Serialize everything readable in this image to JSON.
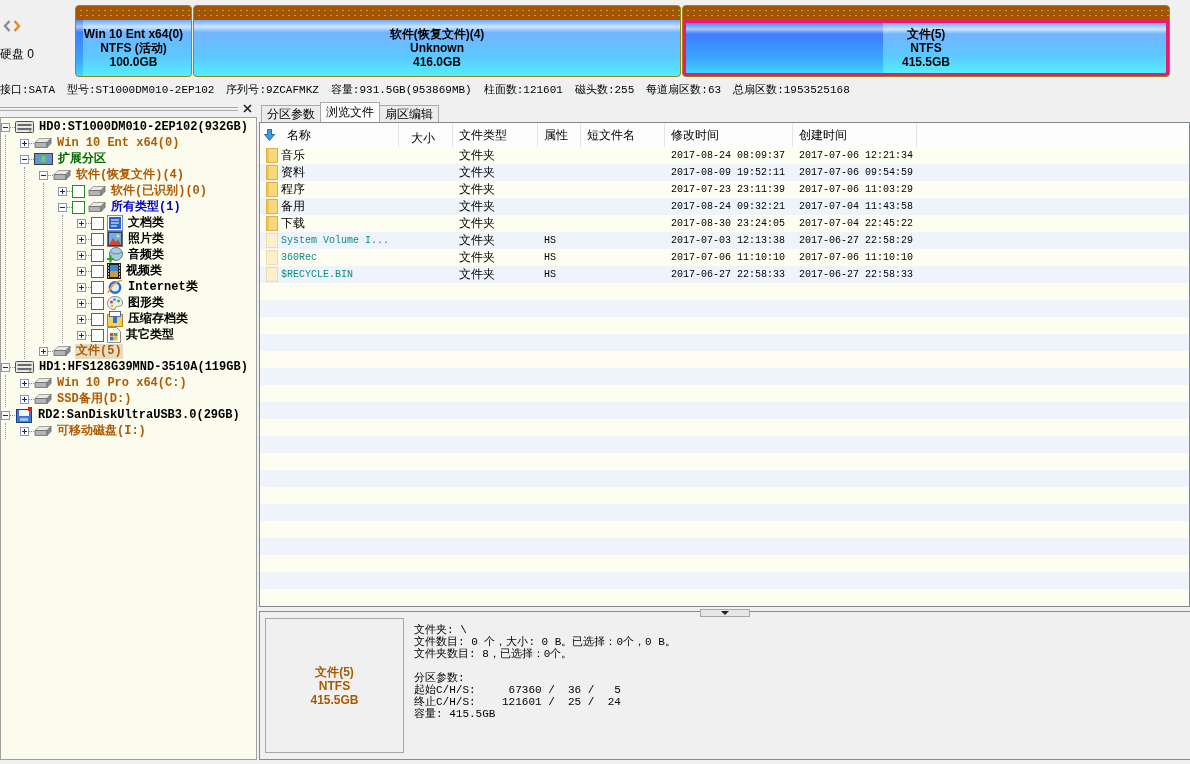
{
  "nav": {
    "disk_label": "硬盘 0"
  },
  "partitions": [
    {
      "name": "Win 10 Ent x64(0)",
      "filesystem": "NTFS (活动)",
      "size": "100.0GB",
      "level": 0.06,
      "selected": false
    },
    {
      "name": "软件(恢复文件)(4)",
      "filesystem": "Unknown",
      "size": "416.0GB",
      "selected": false
    },
    {
      "name": "文件(5)",
      "filesystem": "NTFS",
      "size": "415.5GB",
      "level": 0.41,
      "selected": true
    }
  ],
  "disk_info": [
    "接口:SATA",
    "型号:ST1000DM010-2EP102",
    "序列号:9ZCAFMKZ",
    "容量:931.5GB(953869MB)",
    "柱面数:121601",
    "磁头数:255",
    "每道扇区数:63",
    "总扇区数:1953525168"
  ],
  "tree": [
    {
      "label": "HD0:ST1000DM010-2EP102(932GB)",
      "kind": "disk",
      "color": "#000000",
      "expanded": true,
      "selected": false,
      "children": [
        {
          "label": "Win 10 Ent x64(0)",
          "kind": "partition",
          "color": "#b05a00",
          "expanded": false,
          "selected": false
        },
        {
          "label": "扩展分区",
          "kind": "extended",
          "color": "#006a00",
          "expanded": true,
          "selected": false,
          "children": [
            {
              "label": "软件(恢复文件)(4)",
              "kind": "partition",
              "color": "#b05a00",
              "expanded": true,
              "selected": false,
              "children": [
                {
                  "label": "软件(已识别)(0)",
                  "kind": "partition",
                  "color": "#b05a00",
                  "checked": false,
                  "expanded": false,
                  "selected": false
                },
                {
                  "label": "所有类型(1)",
                  "kind": "partition",
                  "color": "#0000c0",
                  "checked": false,
                  "expanded": true,
                  "selected": false,
                  "children": [
                    {
                      "label": "文档类",
                      "kind": "document",
                      "color": "#000000",
                      "checked": false,
                      "expanded": false,
                      "selected": false
                    },
                    {
                      "label": "照片类",
                      "kind": "photo",
                      "color": "#000000",
                      "checked": false,
                      "expanded": false,
                      "selected": false
                    },
                    {
                      "label": "音频类",
                      "kind": "audio",
                      "color": "#000000",
                      "checked": false,
                      "expanded": false,
                      "selected": false
                    },
                    {
                      "label": "视频类",
                      "kind": "video",
                      "color": "#000000",
                      "checked": false,
                      "expanded": false,
                      "selected": false
                    },
                    {
                      "label": "Internet类",
                      "kind": "internet",
                      "color": "#000000",
                      "checked": false,
                      "expanded": false,
                      "selected": false
                    },
                    {
                      "label": "图形类",
                      "kind": "graphics",
                      "color": "#000000",
                      "checked": false,
                      "expanded": false,
                      "selected": false
                    },
                    {
                      "label": "压缩存档类",
                      "kind": "archive",
                      "color": "#000000",
                      "checked": false,
                      "expanded": false,
                      "selected": false
                    },
                    {
                      "label": "其它类型",
                      "kind": "other",
                      "color": "#000000",
                      "checked": false,
                      "expanded": false,
                      "selected": false
                    }
                  ]
                }
              ]
            },
            {
              "label": "文件(5)",
              "kind": "partition",
              "color": "#b05a00",
              "expanded": false,
              "selected": true
            }
          ]
        }
      ]
    },
    {
      "label": "HD1:HFS128G39MND-3510A(119GB)",
      "kind": "disk",
      "color": "#000000",
      "expanded": true,
      "selected": false,
      "children": [
        {
          "label": "Win 10 Pro x64(C:)",
          "kind": "partition",
          "color": "#b05a00",
          "expanded": false,
          "selected": false
        },
        {
          "label": "SSD备用(D:)",
          "kind": "partition",
          "color": "#b05a00",
          "expanded": false,
          "selected": false
        }
      ]
    },
    {
      "label": "RD2:SanDiskUltraUSB3.0(29GB)",
      "kind": "removable",
      "color": "#000000",
      "expanded": true,
      "selected": false,
      "children": [
        {
          "label": "可移动磁盘(I:)",
          "kind": "partition",
          "color": "#b05a00",
          "expanded": false,
          "selected": false
        }
      ]
    }
  ],
  "tabs": [
    {
      "label": "分区参数",
      "selected": false
    },
    {
      "label": "浏览文件",
      "selected": true
    },
    {
      "label": "扇区编辑",
      "selected": false
    }
  ],
  "file_list": {
    "columns": [
      {
        "label": "名称",
        "sorted": true
      },
      {
        "label": "大小",
        "sorted": false
      },
      {
        "label": "文件类型",
        "sorted": false
      },
      {
        "label": "属性",
        "sorted": false
      },
      {
        "label": "短文件名",
        "sorted": false
      },
      {
        "label": "修改时间",
        "sorted": false
      },
      {
        "label": "创建时间",
        "sorted": false
      }
    ],
    "rows": [
      {
        "name": "音乐",
        "type": "文件夹",
        "modified": "2017-08-24 08:09:37",
        "created": "2017-07-06 12:21:34",
        "hidden": false,
        "selected": false
      },
      {
        "name": "资料",
        "type": "文件夹",
        "modified": "2017-08-09 19:52:11",
        "created": "2017-07-06 09:54:59",
        "hidden": false,
        "selected": false
      },
      {
        "name": "程序",
        "type": "文件夹",
        "modified": "2017-07-23 23:11:39",
        "created": "2017-07-06 11:03:29",
        "hidden": false,
        "selected": false
      },
      {
        "name": "备用",
        "type": "文件夹",
        "modified": "2017-08-24 09:32:21",
        "created": "2017-07-04 11:43:58",
        "hidden": false,
        "selected": false
      },
      {
        "name": "下载",
        "type": "文件夹",
        "modified": "2017-08-30 23:24:05",
        "created": "2017-07-04 22:45:22",
        "hidden": false,
        "selected": false
      },
      {
        "name": "System Volume I...",
        "type": "文件夹",
        "attributes": "HS",
        "modified": "2017-07-03 12:13:38",
        "created": "2017-06-27 22:58:29",
        "hidden": true,
        "selected": false
      },
      {
        "name": "360Rec",
        "type": "文件夹",
        "attributes": "HS",
        "modified": "2017-07-06 11:10:10",
        "created": "2017-07-06 11:10:10",
        "hidden": true,
        "selected": false
      },
      {
        "name": "$RECYCLE.BIN",
        "type": "文件夹",
        "attributes": "HS",
        "modified": "2017-06-27 22:58:33",
        "created": "2017-06-27 22:58:33",
        "hidden": true,
        "selected": false
      }
    ]
  },
  "details": {
    "card": {
      "name": "文件(5)",
      "filesystem": "NTFS",
      "size": "415.5GB"
    },
    "folder_lines": [
      "文件夹: \\",
      "文件数目: 0 个，大小: 0 B。已选择：0个，0 B。",
      "文件夹数目: 8，已选择：0个。"
    ],
    "params_title": "分区参数:",
    "params_lines": [
      "起始C/H/S:     67360 /  36 /   5",
      "终止C/H/S:    121601 /  25 /  24",
      "容量: 415.5GB"
    ]
  }
}
